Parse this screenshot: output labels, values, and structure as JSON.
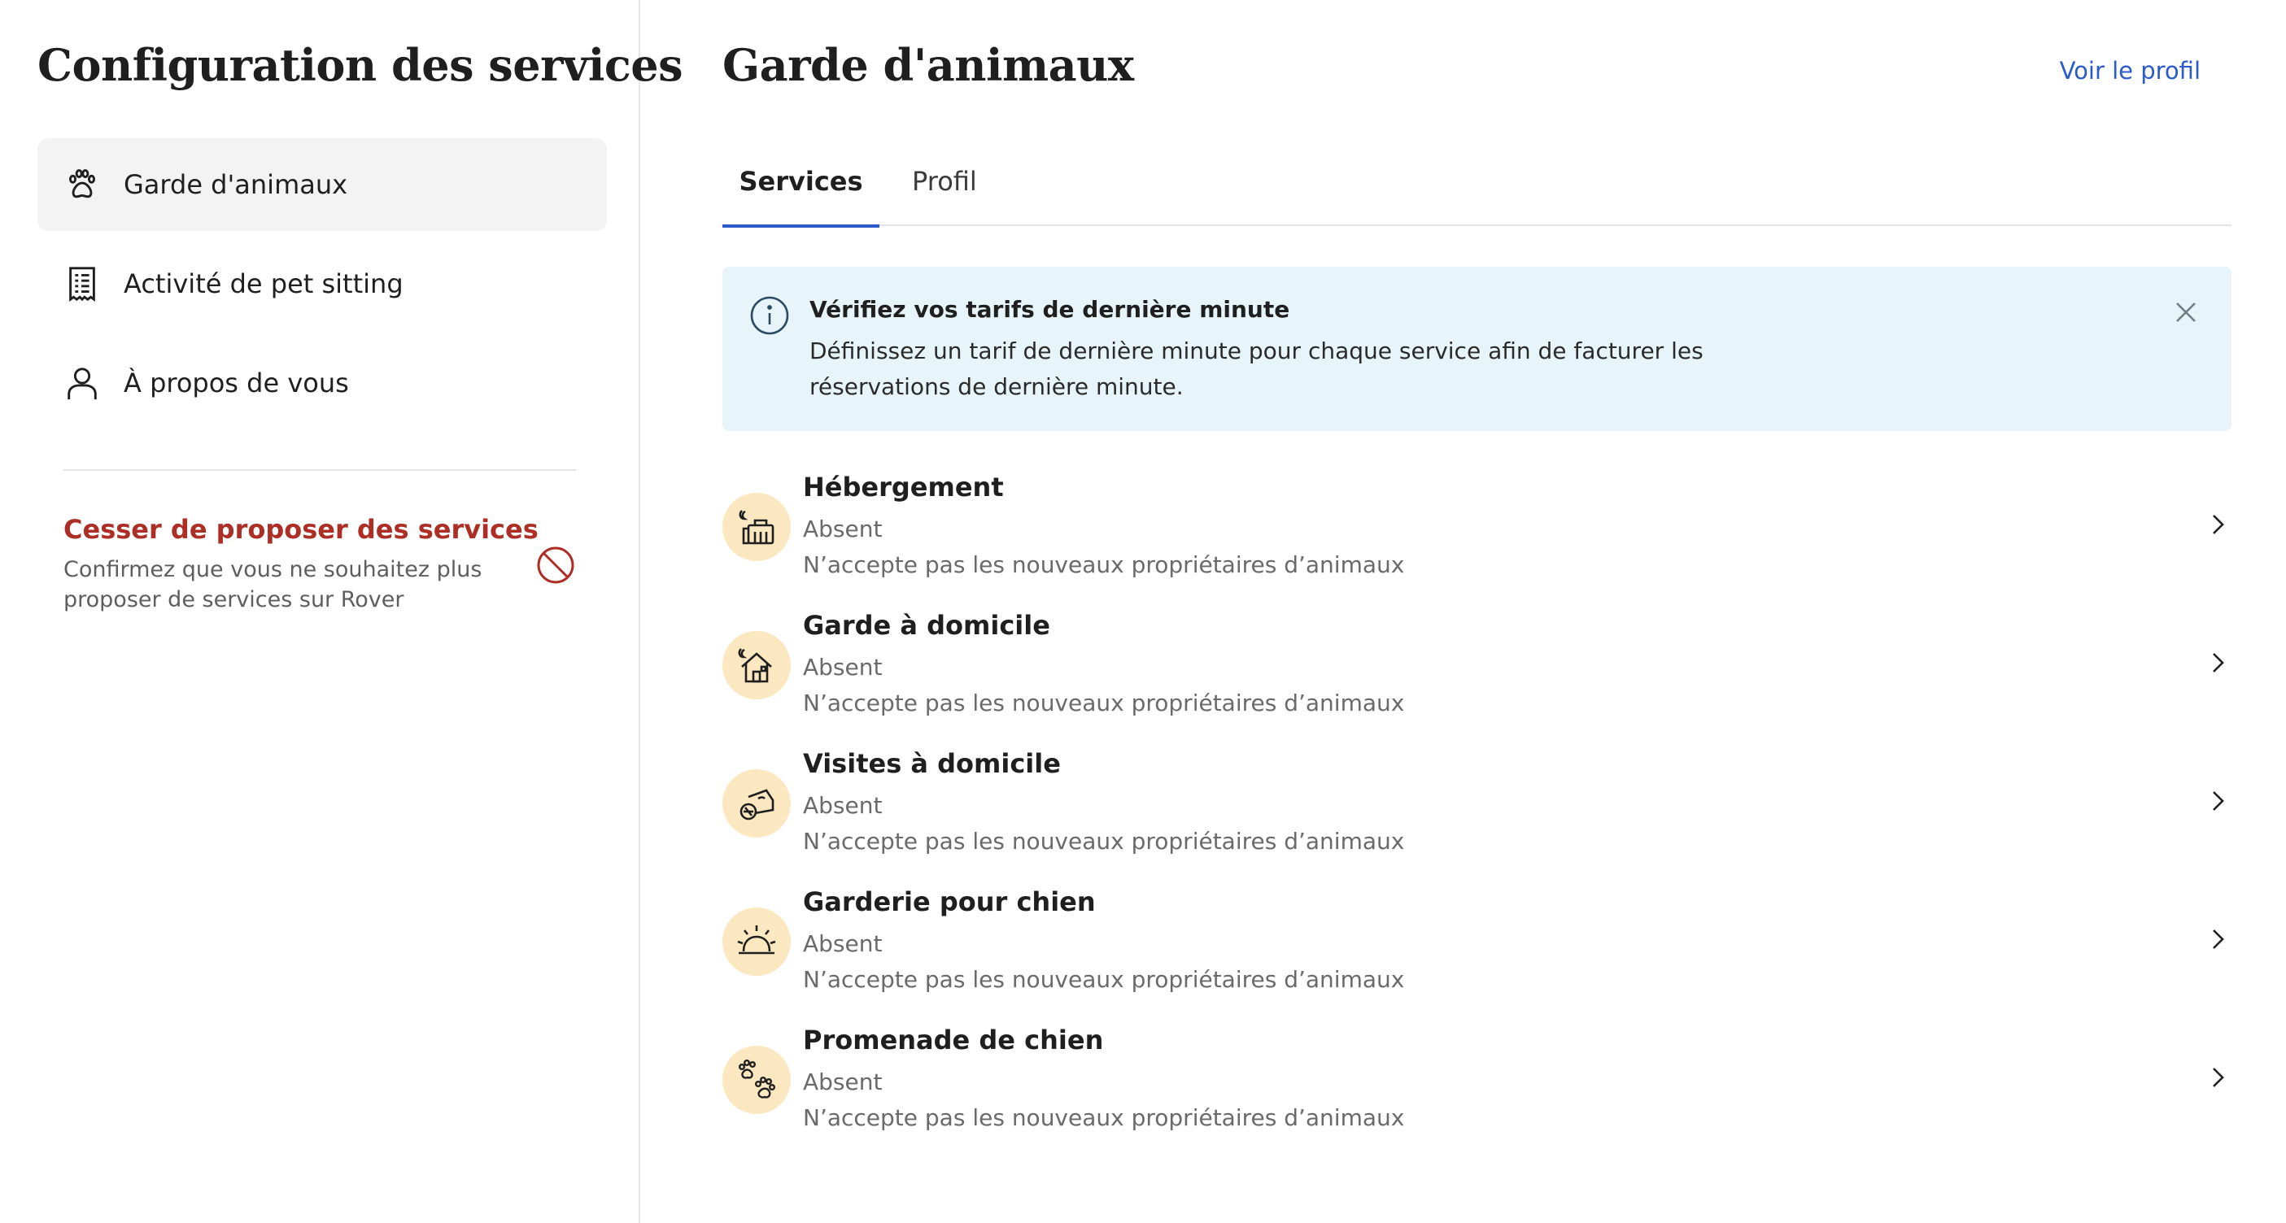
{
  "sidebar": {
    "title": "Configuration des services",
    "items": [
      {
        "label": "Garde d'animaux",
        "icon": "paw-icon",
        "active": true
      },
      {
        "label": "Activité de pet sitting",
        "icon": "receipt-icon",
        "active": false
      },
      {
        "label": "À propos de vous",
        "icon": "person-icon",
        "active": false
      }
    ],
    "stop": {
      "title": "Cesser de proposer des services",
      "description": "Confirmez que vous ne souhaitez plus proposer de services sur Rover",
      "icon": "prohibited-icon"
    }
  },
  "main": {
    "title": "Garde d'animaux",
    "profile_link": "Voir le profil",
    "tabs": [
      {
        "label": "Services",
        "active": true
      },
      {
        "label": "Profil",
        "active": false
      }
    ],
    "banner": {
      "icon": "info-icon",
      "title": "Vérifiez vos tarifs de dernière minute",
      "text": "Définissez un tarif de dernière minute pour chaque service afin de facturer les réservations de dernière minute.",
      "close_icon": "close-icon"
    },
    "services": [
      {
        "name": "Hébergement",
        "status": "Absent",
        "note": "N’accepte pas les nouveaux propriétaires d’animaux",
        "icon": "boarding-icon"
      },
      {
        "name": "Garde à domicile",
        "status": "Absent",
        "note": "N’accepte pas les nouveaux propriétaires d’animaux",
        "icon": "house-sitting-icon"
      },
      {
        "name": "Visites à domicile",
        "status": "Absent",
        "note": "N’accepte pas les nouveaux propriétaires d’animaux",
        "icon": "drop-in-visits-icon"
      },
      {
        "name": "Garderie pour chien",
        "status": "Absent",
        "note": "N’accepte pas les nouveaux propriétaires d’animaux",
        "icon": "doggy-day-care-icon"
      },
      {
        "name": "Promenade de chien",
        "status": "Absent",
        "note": "N’accepte pas les nouveaux propriétaires d’animaux",
        "icon": "dog-walking-icon"
      }
    ]
  },
  "colors": {
    "accent_blue": "#2c5ac8",
    "danger_red": "#ad2e25",
    "banner_bg": "#e7f5fb",
    "badge_bg": "#fbe7c0",
    "active_nav_bg": "#f3f3f3"
  }
}
